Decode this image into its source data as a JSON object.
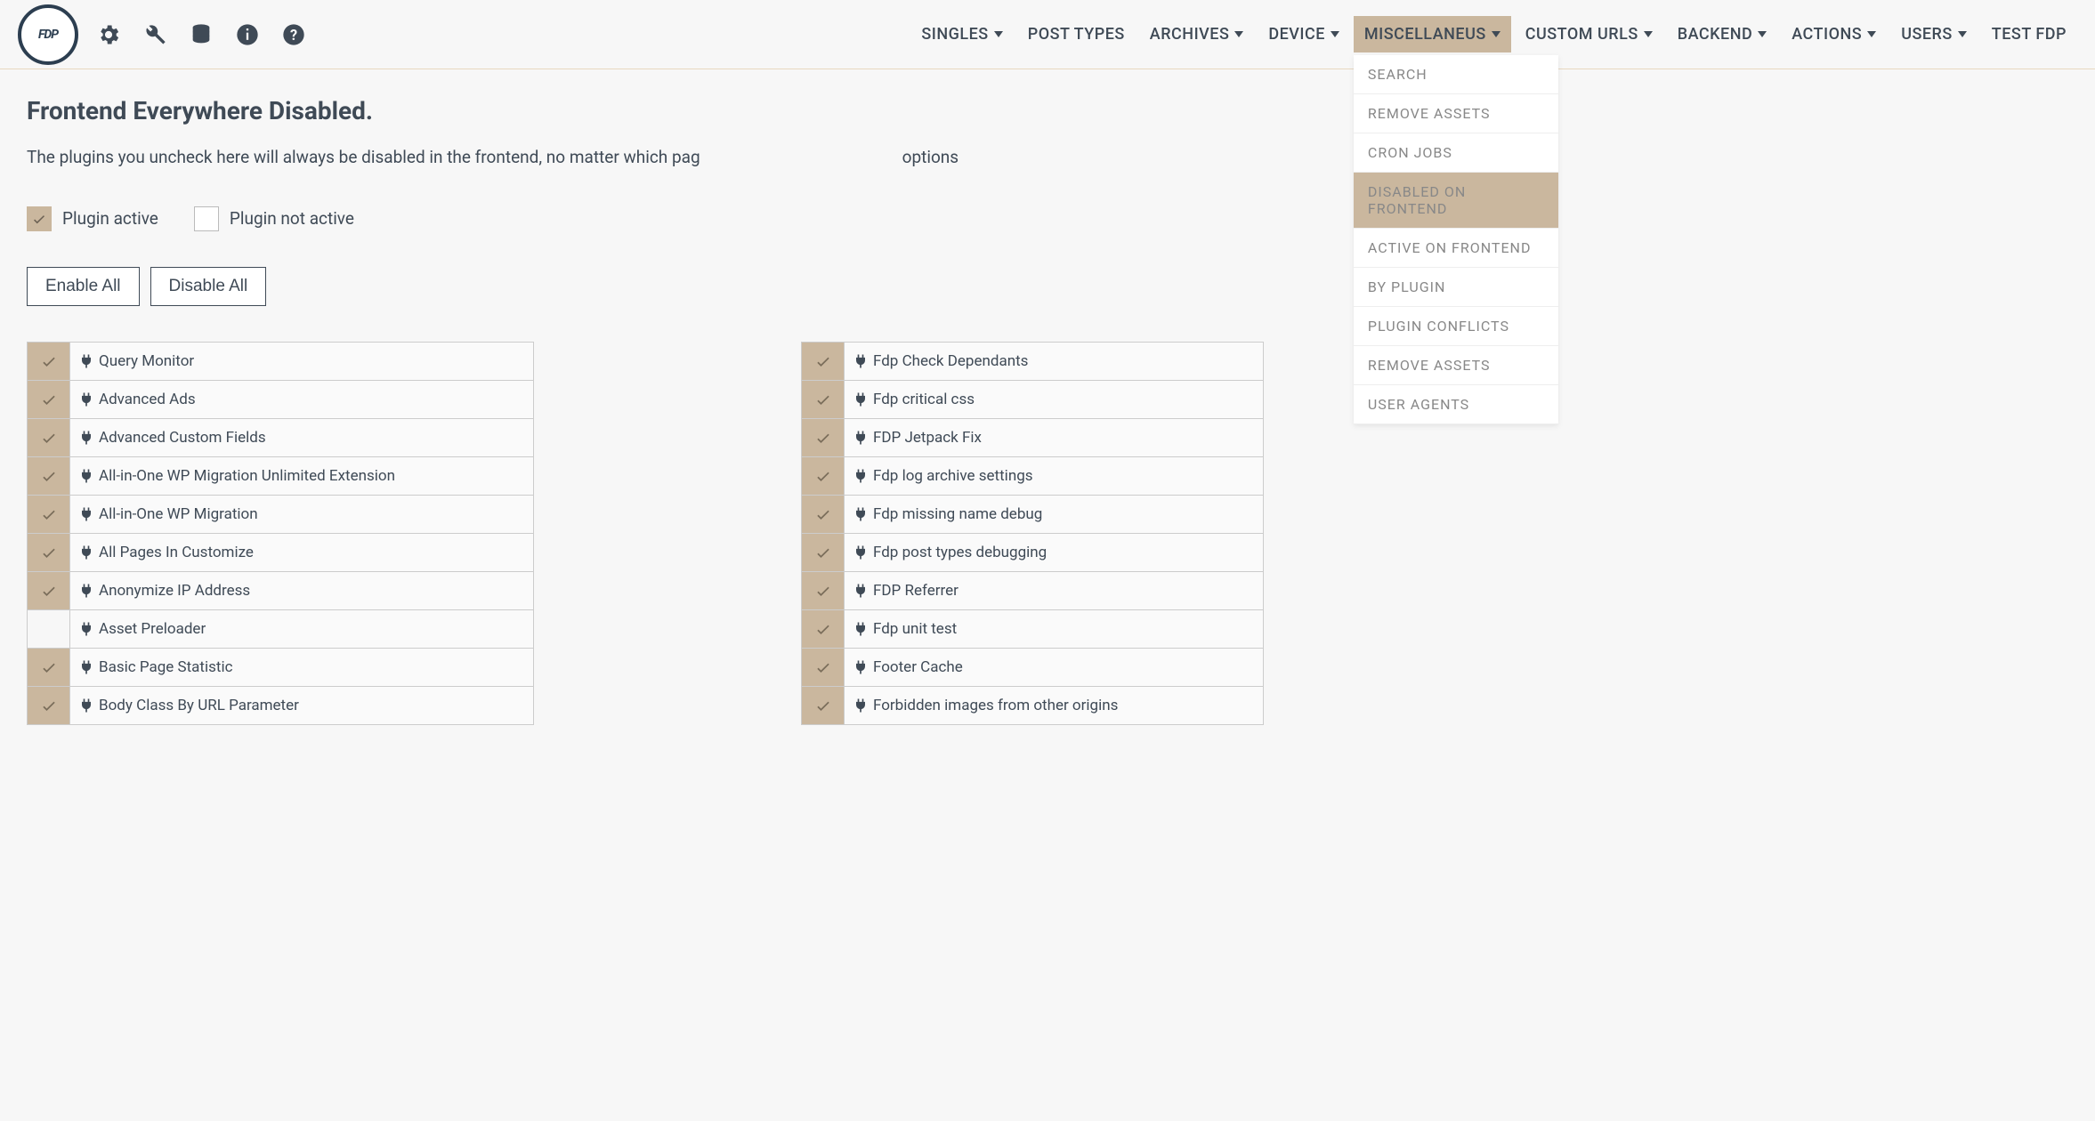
{
  "header": {
    "logo_text": "FDP"
  },
  "nav": {
    "items": [
      "SINGLES",
      "POST TYPES",
      "ARCHIVES",
      "DEVICE",
      "MISCELLANEUS",
      "CUSTOM URLS",
      "BACKEND",
      "ACTIONS",
      "USERS",
      "TEST FDP"
    ],
    "has_dropdown": [
      true,
      false,
      true,
      true,
      true,
      true,
      true,
      true,
      true,
      false
    ],
    "active_index": 4
  },
  "dropdown": {
    "items": [
      "SEARCH",
      "REMOVE ASSETS",
      "CRON JOBS",
      "DISABLED ON FRONTEND",
      "ACTIVE ON FRONTEND",
      "BY PLUGIN",
      "PLUGIN CONFLICTS",
      "REMOVE ASSETS",
      "USER AGENTS"
    ],
    "active_index": 3
  },
  "page": {
    "title": "Frontend Everywhere Disabled.",
    "description_prefix": "The plugins you uncheck here will always be disabled in the frontend, no matter which pag",
    "description_suffix": " options"
  },
  "legend": {
    "active": "Plugin active",
    "inactive": "Plugin not active"
  },
  "buttons": {
    "enable_all": "Enable All",
    "disable_all": "Disable All"
  },
  "plugins_left": [
    {
      "name": "Query Monitor",
      "checked": true
    },
    {
      "name": "Advanced Ads",
      "checked": true
    },
    {
      "name": "Advanced Custom Fields",
      "checked": true
    },
    {
      "name": "All-in-One WP Migration Unlimited Extension",
      "checked": true
    },
    {
      "name": "All-in-One WP Migration",
      "checked": true
    },
    {
      "name": "All Pages In Customize",
      "checked": true
    },
    {
      "name": "Anonymize IP Address",
      "checked": true
    },
    {
      "name": "Asset Preloader",
      "checked": false
    },
    {
      "name": "Basic Page Statistic",
      "checked": true
    },
    {
      "name": "Body Class By URL Parameter",
      "checked": true
    }
  ],
  "plugins_right": [
    {
      "name": "Fdp Check Dependants",
      "checked": true
    },
    {
      "name": "Fdp critical css",
      "checked": true
    },
    {
      "name": "FDP Jetpack Fix",
      "checked": true
    },
    {
      "name": "Fdp log archive settings",
      "checked": true
    },
    {
      "name": "Fdp missing name debug",
      "checked": true
    },
    {
      "name": "Fdp post types debugging",
      "checked": true
    },
    {
      "name": "FDP Referrer",
      "checked": true
    },
    {
      "name": "Fdp unit test",
      "checked": true
    },
    {
      "name": "Footer Cache",
      "checked": true
    },
    {
      "name": "Forbidden images from other origins",
      "checked": true
    }
  ]
}
